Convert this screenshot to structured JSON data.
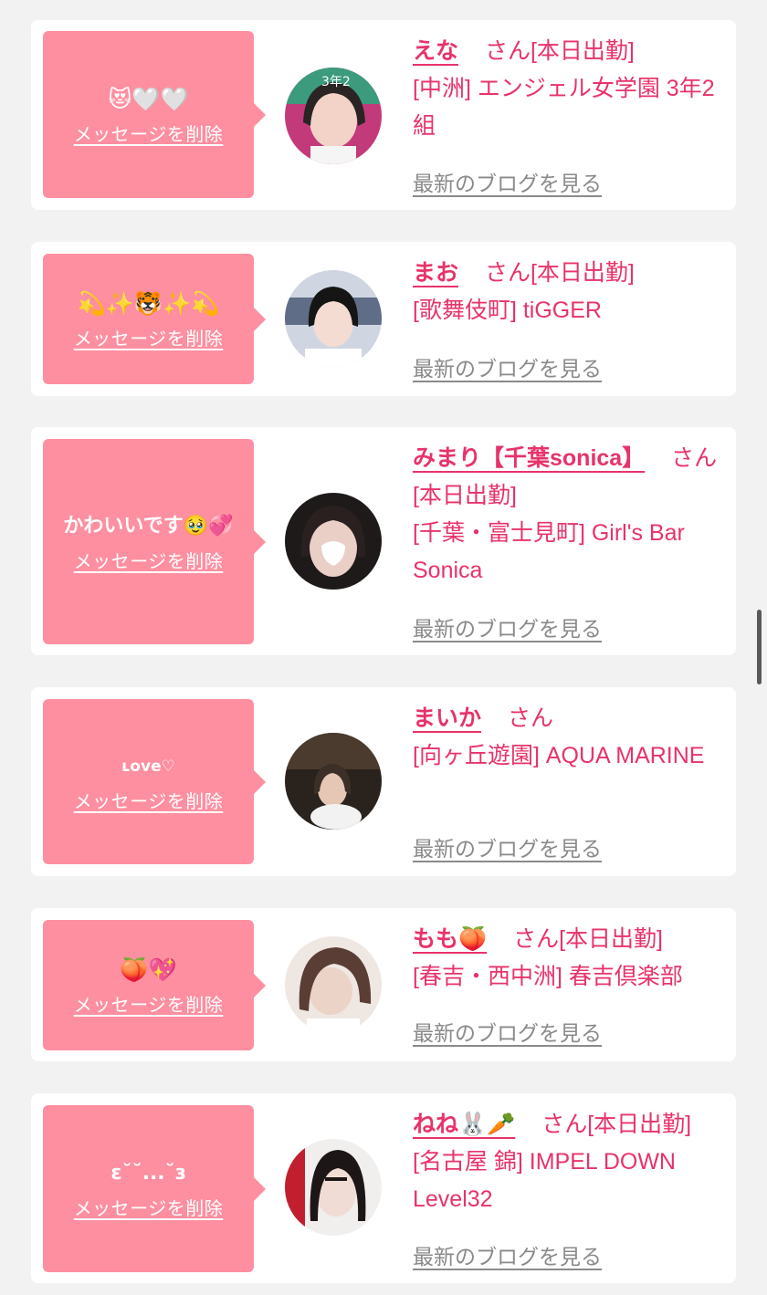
{
  "delete_label": "メッセージを削除",
  "blog_label": "最新のブログを見る",
  "san_label": "さん",
  "cards": [
    {
      "message": "😻🤍🤍",
      "name": "えな",
      "status": "[本日出勤]",
      "shop": "[中洲] エンジェル女学園 3年2組"
    },
    {
      "message": "💫✨🐯✨💫",
      "name": "まお",
      "status": "[本日出勤]",
      "shop": "[歌舞伎町] tiGGER"
    },
    {
      "message": "かわいいです🥹💞",
      "name": "みまり【千葉sonica】",
      "status": "[本日出勤]",
      "shop": "[千葉・富士見町] Girl's Bar Sonica"
    },
    {
      "message": "ʟove♡",
      "name": "まいか",
      "status": "",
      "shop": "[向ヶ丘遊園] AQUA MARINE"
    },
    {
      "message": "🍑💖",
      "name": "もも🍑",
      "status": "[本日出勤]",
      "shop": "[春吉・西中洲] 春吉倶楽部"
    },
    {
      "message": "ɛ˘˘...˘ɜ",
      "name": "ねね🐰🥕",
      "status": "[本日出勤]",
      "shop": "[名古屋 錦] IMPEL DOWN Level32"
    }
  ],
  "colors": {
    "background": "#f2f2f2",
    "card": "#ffffff",
    "bubble": "#fd8fa0",
    "accent_text": "#e8336a",
    "link_gray": "#8a8a8a"
  },
  "icons": [
    "avatar-photo",
    "bubble-pointer"
  ]
}
